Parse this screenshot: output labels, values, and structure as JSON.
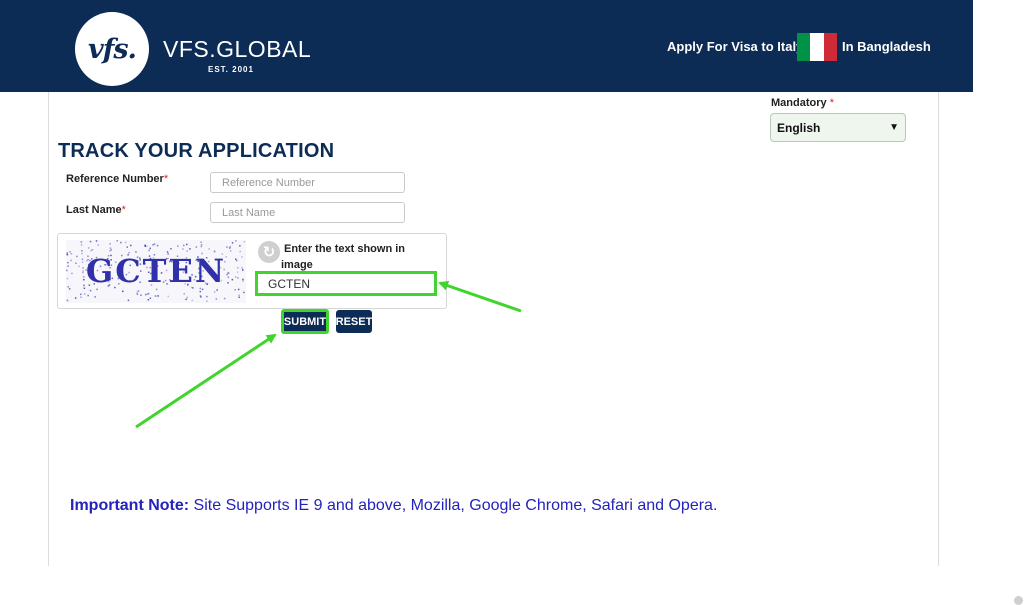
{
  "header": {
    "logo_mark": "vfs.",
    "brand_name": "VFS.GLOBAL",
    "brand_est": "EST. 2001",
    "apply_text": "Apply For Visa to Italy",
    "country_text": "In Bangladesh",
    "flag_colors": [
      "#009246",
      "#ffffff",
      "#ce2b37"
    ]
  },
  "language": {
    "mandatory_label": "Mandatory",
    "required_mark": "*",
    "selected": "English"
  },
  "form": {
    "title": "TRACK YOUR APPLICATION",
    "reference": {
      "label": "Reference Number",
      "required_mark": "*",
      "placeholder": "Reference Number"
    },
    "last_name": {
      "label": "Last Name",
      "required_mark": "*",
      "placeholder": "Last Name"
    },
    "captcha": {
      "image_text": "GCTEN",
      "prompt_line1": "Enter the text shown in",
      "prompt_line2": "image",
      "value": "GCTEN",
      "refresh_icon": "refresh-icon"
    },
    "submit_label": "SUBMIT",
    "reset_label": "RESET"
  },
  "note": {
    "label": "Important Note:",
    "text": " Site Supports IE 9 and above, Mozilla, Google Chrome, Safari and Opera."
  },
  "colors": {
    "header_bg": "#0c2b55",
    "highlight": "#42d42e",
    "note_text": "#2323bb"
  }
}
